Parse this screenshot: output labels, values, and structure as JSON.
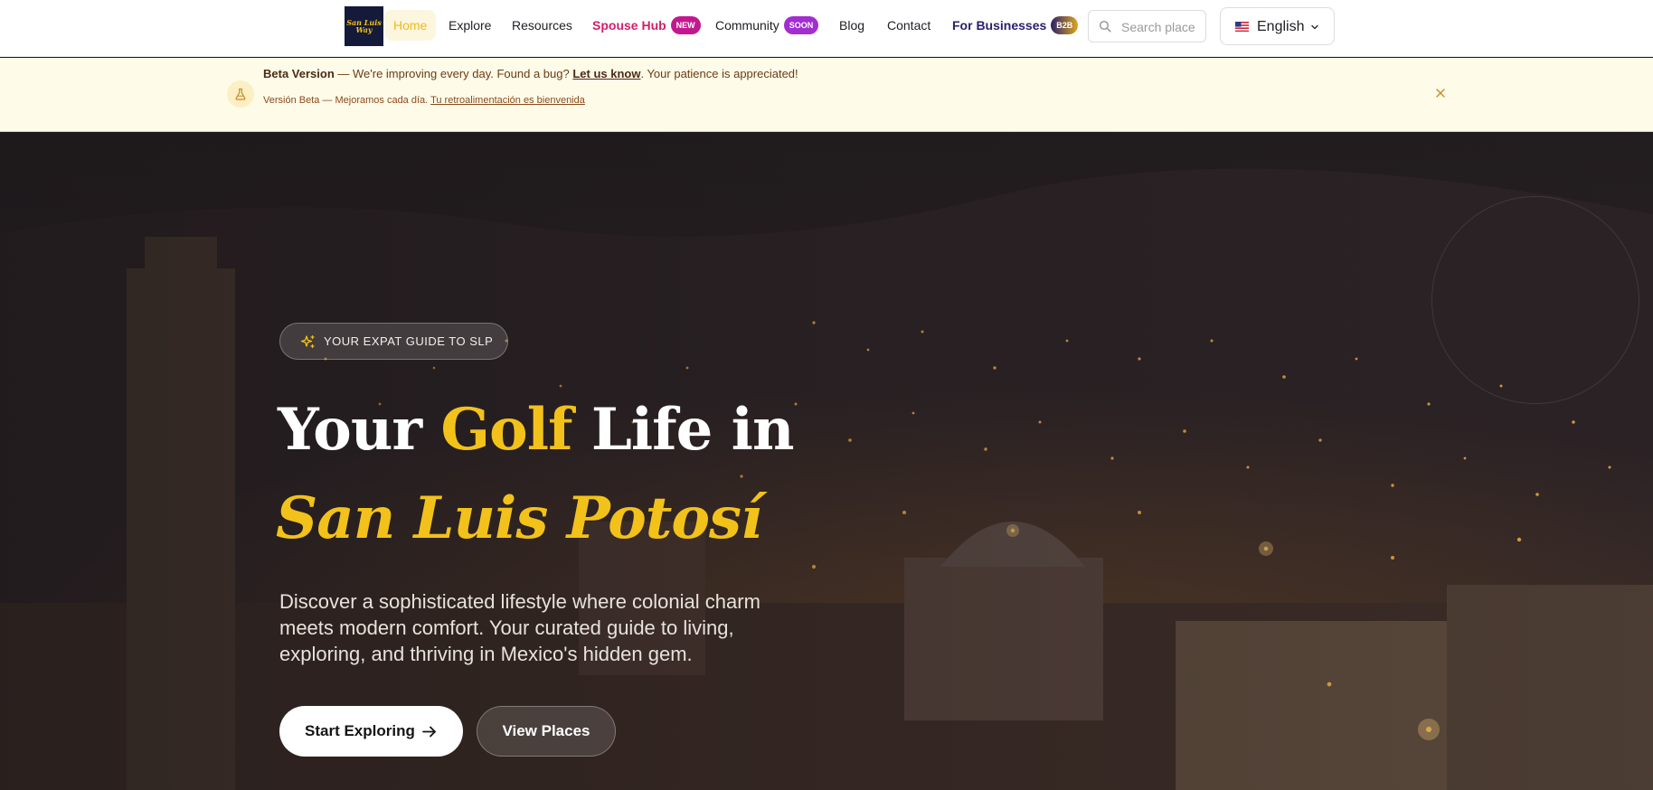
{
  "nav": {
    "logo_text": "San Luis Way",
    "links": [
      {
        "label": "Home",
        "active": true
      },
      {
        "label": "Explore"
      },
      {
        "label": "Resources"
      },
      {
        "label": "Spouse Hub",
        "badge": "NEW"
      },
      {
        "label": "Community",
        "badge": "SOON"
      },
      {
        "label": "Blog"
      },
      {
        "label": "Contact"
      },
      {
        "label": "For Businesses",
        "badge": "B2B"
      }
    ],
    "search": {
      "placeholder": "Search place",
      "icon": "search-icon"
    },
    "language": {
      "label": "English",
      "flag": "us-flag-icon",
      "icon": "chevron-down-icon"
    }
  },
  "banner": {
    "title": "Beta Version",
    "message": " — We're improving every day. Found a bug? ",
    "link": "Let us know",
    "suffix": ". Your patience is appreciated!",
    "es_text": "Versión Beta — Mejoramos cada día. ",
    "es_link": "Tu retroalimentación es bienvenida",
    "icon": "beaker-icon",
    "close_icon": "close-icon"
  },
  "hero": {
    "tag": "YOUR EXPAT GUIDE TO SLP",
    "headline_pre": "Your ",
    "headline_highlight": "Golf",
    "headline_post": " Life in",
    "headline_city": "San Luis Potosí",
    "subtitle": "Discover a sophisticated lifestyle where colonial charm meets modern comfort. Your curated guide to living, exploring, and thriving in Mexico's hidden gem.",
    "primary_cta": "Start Exploring",
    "secondary_cta": "View Places"
  },
  "colors": {
    "accent_gold": "#f2c21b",
    "spouse_hub": "#d01f6a",
    "new_badge": "#c2188f",
    "soon_badge": "#a12ecf",
    "for_business": "#2a1f6b",
    "banner_bg": "#fefbe8",
    "hero_overlay": "#221d20"
  }
}
